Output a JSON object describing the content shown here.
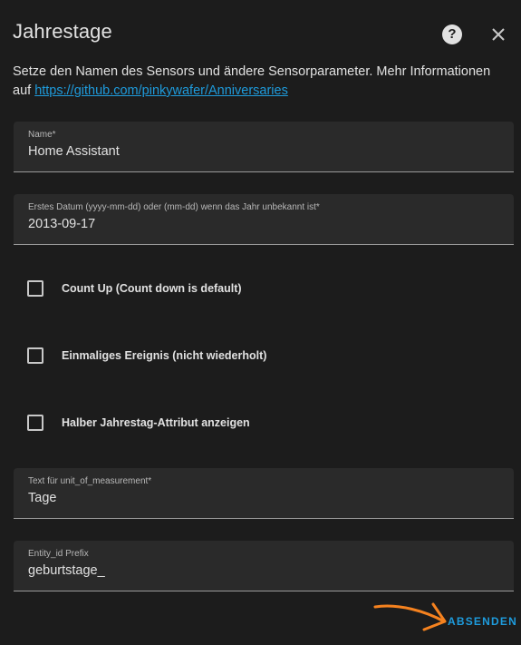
{
  "dialog": {
    "title": "Jahrestage",
    "help_icon": "help-circle-icon",
    "close_icon": "close-icon",
    "description_text": "Setze den Namen des Sensors und ändere Sensorparameter. Mehr Informationen auf ",
    "description_link": "https://github.com/pinkywafer/Anniversaries"
  },
  "fields": {
    "name": {
      "label": "Name*",
      "value": "Home Assistant"
    },
    "date": {
      "label": "Erstes Datum (yyyy-mm-dd) oder (mm-dd) wenn das Jahr unbekannt ist*",
      "value": "2013-09-17"
    },
    "unit": {
      "label": "Text für unit_of_measurement*",
      "value": "Tage"
    },
    "prefix": {
      "label": "Entity_id Prefix",
      "value": "geburtstage_"
    }
  },
  "checkboxes": [
    {
      "label": "Count Up (Count down is default)",
      "checked": false
    },
    {
      "label": "Einmaliges Ereignis (nicht wiederholt)",
      "checked": false
    },
    {
      "label": "Halber Jahrestag-Attribut anzeigen",
      "checked": false
    }
  ],
  "submit_label": "ABSENDEN",
  "colors": {
    "background": "#1c1c1c",
    "field_background": "#2a2a2a",
    "accent": "#1e9bdc",
    "annotation_arrow": "#f5821f"
  }
}
